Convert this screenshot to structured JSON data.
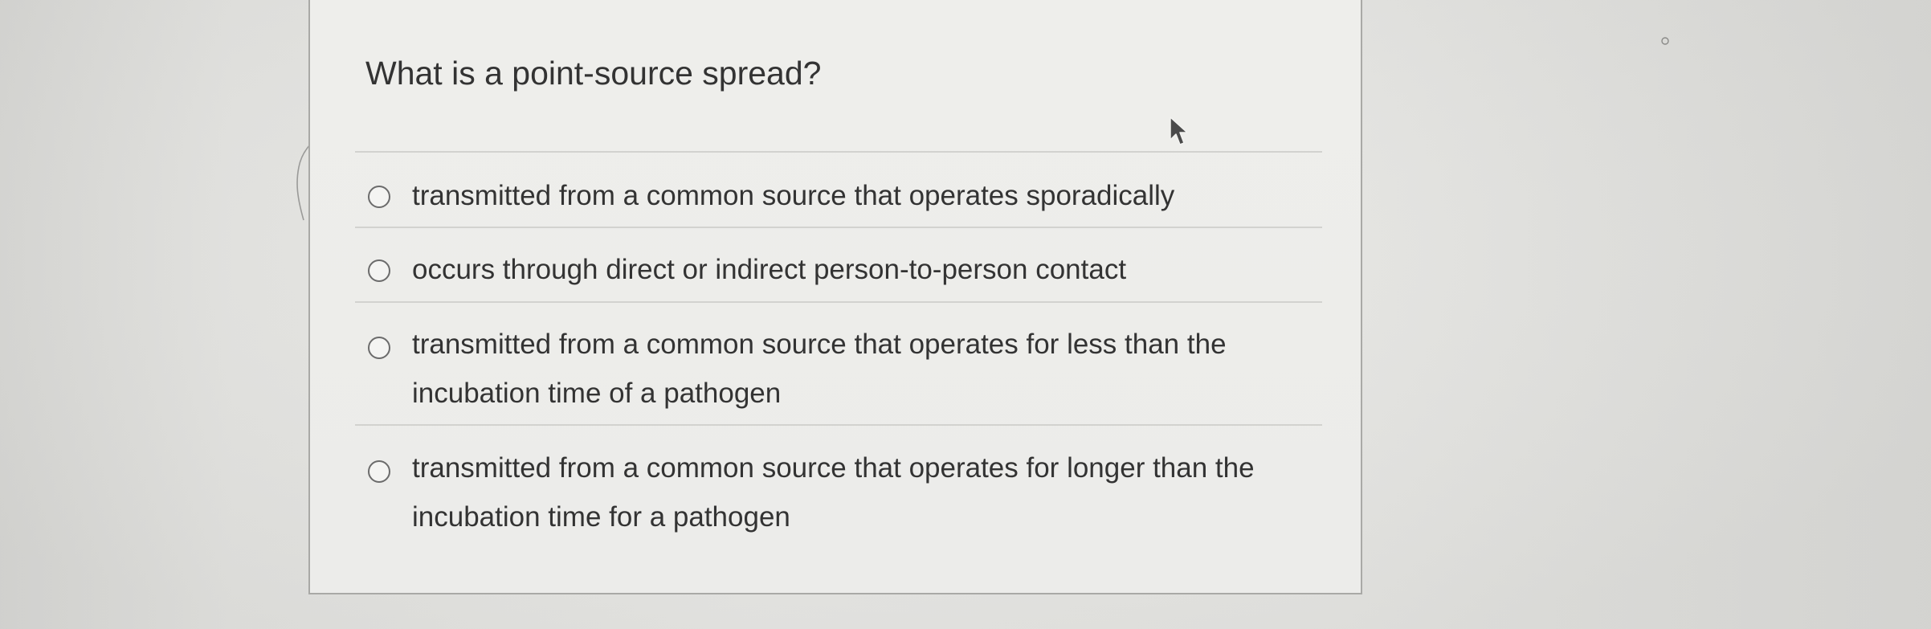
{
  "question": {
    "text": "What is a point-source spread?"
  },
  "options": [
    {
      "label": "transmitted from a common source that operates sporadically",
      "selected": false
    },
    {
      "label": "occurs through direct or indirect person-to-person contact",
      "selected": false
    },
    {
      "label": "transmitted from a common source that operates for less than the incubation time of a pathogen",
      "selected": false
    },
    {
      "label": "transmitted from a common source that operates for longer than the incubation time for a pathogen",
      "selected": false
    }
  ],
  "icons": {
    "radio": "radio-unselected-icon",
    "cursor": "mouse-pointer-icon"
  },
  "colors": {
    "text": "#333333",
    "radio_border": "#6b6b6b",
    "divider": "#d2d2cf",
    "card_border": "#a9a9a6"
  }
}
